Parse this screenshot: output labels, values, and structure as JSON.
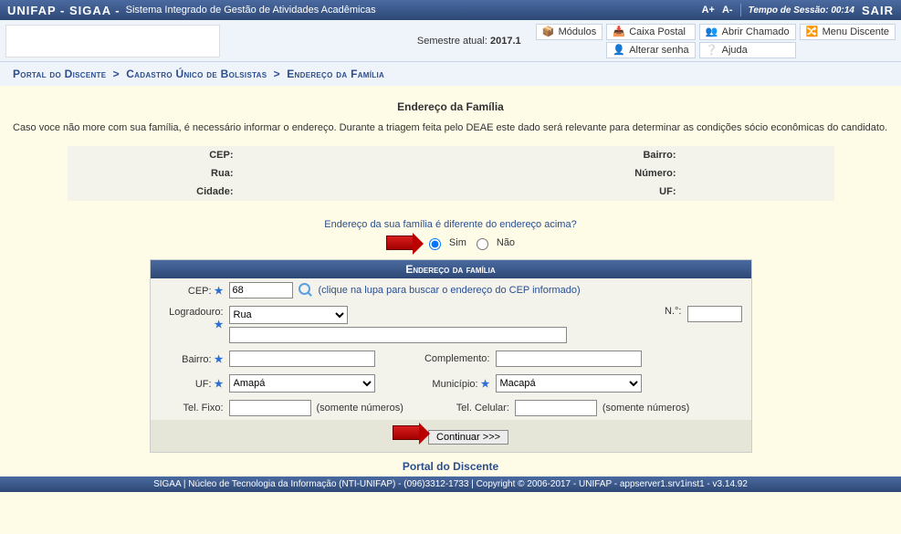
{
  "header": {
    "sys_abbr": "UNIFAP - SIGAA -",
    "sys_desc": "Sistema Integrado de Gestão de Atividades Acadêmicas",
    "a_plus": "A+",
    "a_minus": "A-",
    "session_label": "Tempo de Sessão:",
    "session_time": "00:14",
    "logout": "SAIR"
  },
  "subbar": {
    "semestre_label": "Semestre atual:",
    "semestre_value": "2017.1",
    "links": {
      "modulos": "Módulos",
      "caixa": "Caixa Postal",
      "chamado": "Abrir Chamado",
      "menu_discente": "Menu Discente",
      "alterar_senha": "Alterar senha",
      "ajuda": "Ajuda"
    }
  },
  "breadcrumb": {
    "portal": "Portal do Discente",
    "cadastro": "Cadastro Único de Bolsistas",
    "endereco": "Endereço da Família"
  },
  "section": {
    "title": "Endereço da Família",
    "note": "Caso voce não more com sua família, é necessário informar o endereço. Durante a triagem feita pelo DEAE este dado será relevante para determinar as condições sócio econômicas do candidato."
  },
  "current_addr": {
    "cep_label": "CEP:",
    "cep_value": "",
    "rua_label": "Rua:",
    "rua_value": "",
    "cidade_label": "Cidade:",
    "cidade_value": "",
    "bairro_label": "Bairro:",
    "bairro_value": "",
    "numero_label": "Número:",
    "numero_value": "",
    "uf_label": "UF:",
    "uf_value": ""
  },
  "question": {
    "text": "Endereço da sua família é diferente do endereço acima?",
    "sim": "Sim",
    "nao": "Não",
    "selected": "sim"
  },
  "form": {
    "panel_title": "Endereço da família",
    "cep_label": "CEP:",
    "cep_value": "68",
    "cep_hint": "(clique na lupa para buscar o endereço do CEP informado)",
    "logradouro_label": "Logradouro:",
    "logradouro_tipo": "Rua",
    "logradouro_value": "",
    "numero_label": "N.°:",
    "numero_value": "",
    "bairro_label": "Bairro:",
    "bairro_value": "",
    "complemento_label": "Complemento:",
    "complemento_value": "",
    "uf_label": "UF:",
    "uf_value": "Amapá",
    "municipio_label": "Município:",
    "municipio_value": "Macapá",
    "tel_fixo_label": "Tel. Fixo:",
    "tel_fixo_value": "",
    "tel_cel_label": "Tel. Celular:",
    "tel_cel_value": "",
    "somente_numeros": "(somente números)",
    "continuar": "Continuar >>>"
  },
  "portal_link": "Portal do Discente",
  "footer": "SIGAA | Núcleo de Tecnologia da Informação (NTI-UNIFAP) - (096)3312-1733 | Copyright © 2006-2017 - UNIFAP - appserver1.srv1inst1 - v3.14.92"
}
